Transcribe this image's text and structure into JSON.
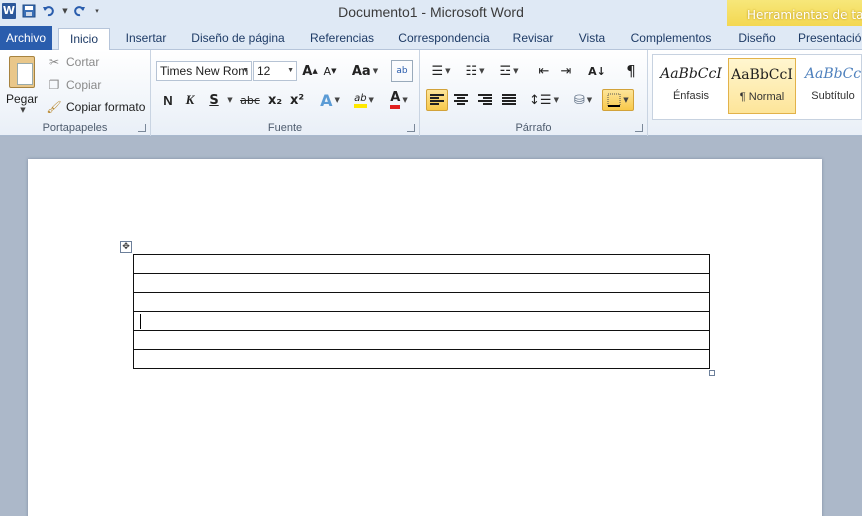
{
  "app": {
    "doc_title": "Documento1",
    "separator": "-",
    "app_name": "Microsoft Word",
    "contextual_tools": "Herramientas de tabla"
  },
  "tabs": [
    {
      "label": "Archivo"
    },
    {
      "label": "Inicio"
    },
    {
      "label": "Insertar"
    },
    {
      "label": "Diseño de página"
    },
    {
      "label": "Referencias"
    },
    {
      "label": "Correspondencia"
    },
    {
      "label": "Revisar"
    },
    {
      "label": "Vista"
    },
    {
      "label": "Complementos"
    },
    {
      "label": "Diseño"
    },
    {
      "label": "Presentació"
    }
  ],
  "clipboard": {
    "paste": "Pegar",
    "cut": "Cortar",
    "copy": "Copiar",
    "format_painter": "Copiar formato",
    "group": "Portapapeles"
  },
  "font": {
    "name": "Times New Rom",
    "size": "12",
    "change_case": "Aa",
    "bold": "N",
    "italic": "K",
    "underline": "S",
    "strike": "abc",
    "subscript": "x₂",
    "superscript": "x²",
    "effects": "A",
    "highlight": "ab",
    "color": "A",
    "group": "Fuente"
  },
  "paragraph": {
    "sort": "A↓",
    "show_marks": "¶",
    "group": "Párrafo"
  },
  "styles": [
    {
      "sample": "AaBbCcI",
      "name": "Énfasis"
    },
    {
      "sample": "AaBbCcI",
      "name": "¶ Normal"
    },
    {
      "sample": "AaBbCc",
      "name": "Subtítulo"
    }
  ],
  "table": {
    "rows": 6
  }
}
